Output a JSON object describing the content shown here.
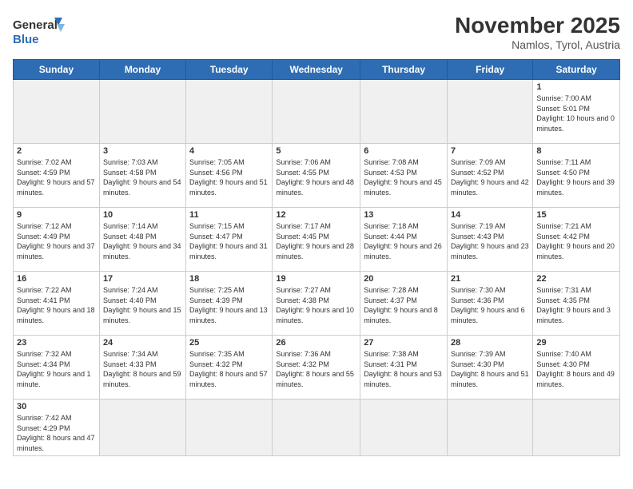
{
  "logo": {
    "line1": "General",
    "line2": "Blue"
  },
  "title": "November 2025",
  "location": "Namlos, Tyrol, Austria",
  "weekdays": [
    "Sunday",
    "Monday",
    "Tuesday",
    "Wednesday",
    "Thursday",
    "Friday",
    "Saturday"
  ],
  "weeks": [
    [
      {
        "day": "",
        "empty": true
      },
      {
        "day": "",
        "empty": true
      },
      {
        "day": "",
        "empty": true
      },
      {
        "day": "",
        "empty": true
      },
      {
        "day": "",
        "empty": true
      },
      {
        "day": "",
        "empty": true
      },
      {
        "day": "1",
        "info": "Sunrise: 7:00 AM\nSunset: 5:01 PM\nDaylight: 10 hours and 0 minutes."
      }
    ],
    [
      {
        "day": "2",
        "info": "Sunrise: 7:02 AM\nSunset: 4:59 PM\nDaylight: 9 hours and 57 minutes."
      },
      {
        "day": "3",
        "info": "Sunrise: 7:03 AM\nSunset: 4:58 PM\nDaylight: 9 hours and 54 minutes."
      },
      {
        "day": "4",
        "info": "Sunrise: 7:05 AM\nSunset: 4:56 PM\nDaylight: 9 hours and 51 minutes."
      },
      {
        "day": "5",
        "info": "Sunrise: 7:06 AM\nSunset: 4:55 PM\nDaylight: 9 hours and 48 minutes."
      },
      {
        "day": "6",
        "info": "Sunrise: 7:08 AM\nSunset: 4:53 PM\nDaylight: 9 hours and 45 minutes."
      },
      {
        "day": "7",
        "info": "Sunrise: 7:09 AM\nSunset: 4:52 PM\nDaylight: 9 hours and 42 minutes."
      },
      {
        "day": "8",
        "info": "Sunrise: 7:11 AM\nSunset: 4:50 PM\nDaylight: 9 hours and 39 minutes."
      }
    ],
    [
      {
        "day": "9",
        "info": "Sunrise: 7:12 AM\nSunset: 4:49 PM\nDaylight: 9 hours and 37 minutes."
      },
      {
        "day": "10",
        "info": "Sunrise: 7:14 AM\nSunset: 4:48 PM\nDaylight: 9 hours and 34 minutes."
      },
      {
        "day": "11",
        "info": "Sunrise: 7:15 AM\nSunset: 4:47 PM\nDaylight: 9 hours and 31 minutes."
      },
      {
        "day": "12",
        "info": "Sunrise: 7:17 AM\nSunset: 4:45 PM\nDaylight: 9 hours and 28 minutes."
      },
      {
        "day": "13",
        "info": "Sunrise: 7:18 AM\nSunset: 4:44 PM\nDaylight: 9 hours and 26 minutes."
      },
      {
        "day": "14",
        "info": "Sunrise: 7:19 AM\nSunset: 4:43 PM\nDaylight: 9 hours and 23 minutes."
      },
      {
        "day": "15",
        "info": "Sunrise: 7:21 AM\nSunset: 4:42 PM\nDaylight: 9 hours and 20 minutes."
      }
    ],
    [
      {
        "day": "16",
        "info": "Sunrise: 7:22 AM\nSunset: 4:41 PM\nDaylight: 9 hours and 18 minutes."
      },
      {
        "day": "17",
        "info": "Sunrise: 7:24 AM\nSunset: 4:40 PM\nDaylight: 9 hours and 15 minutes."
      },
      {
        "day": "18",
        "info": "Sunrise: 7:25 AM\nSunset: 4:39 PM\nDaylight: 9 hours and 13 minutes."
      },
      {
        "day": "19",
        "info": "Sunrise: 7:27 AM\nSunset: 4:38 PM\nDaylight: 9 hours and 10 minutes."
      },
      {
        "day": "20",
        "info": "Sunrise: 7:28 AM\nSunset: 4:37 PM\nDaylight: 9 hours and 8 minutes."
      },
      {
        "day": "21",
        "info": "Sunrise: 7:30 AM\nSunset: 4:36 PM\nDaylight: 9 hours and 6 minutes."
      },
      {
        "day": "22",
        "info": "Sunrise: 7:31 AM\nSunset: 4:35 PM\nDaylight: 9 hours and 3 minutes."
      }
    ],
    [
      {
        "day": "23",
        "info": "Sunrise: 7:32 AM\nSunset: 4:34 PM\nDaylight: 9 hours and 1 minute."
      },
      {
        "day": "24",
        "info": "Sunrise: 7:34 AM\nSunset: 4:33 PM\nDaylight: 8 hours and 59 minutes."
      },
      {
        "day": "25",
        "info": "Sunrise: 7:35 AM\nSunset: 4:32 PM\nDaylight: 8 hours and 57 minutes."
      },
      {
        "day": "26",
        "info": "Sunrise: 7:36 AM\nSunset: 4:32 PM\nDaylight: 8 hours and 55 minutes."
      },
      {
        "day": "27",
        "info": "Sunrise: 7:38 AM\nSunset: 4:31 PM\nDaylight: 8 hours and 53 minutes."
      },
      {
        "day": "28",
        "info": "Sunrise: 7:39 AM\nSunset: 4:30 PM\nDaylight: 8 hours and 51 minutes."
      },
      {
        "day": "29",
        "info": "Sunrise: 7:40 AM\nSunset: 4:30 PM\nDaylight: 8 hours and 49 minutes."
      }
    ],
    [
      {
        "day": "30",
        "info": "Sunrise: 7:42 AM\nSunset: 4:29 PM\nDaylight: 8 hours and 47 minutes."
      },
      {
        "day": "",
        "empty": true
      },
      {
        "day": "",
        "empty": true
      },
      {
        "day": "",
        "empty": true
      },
      {
        "day": "",
        "empty": true
      },
      {
        "day": "",
        "empty": true
      },
      {
        "day": "",
        "empty": true
      }
    ]
  ]
}
